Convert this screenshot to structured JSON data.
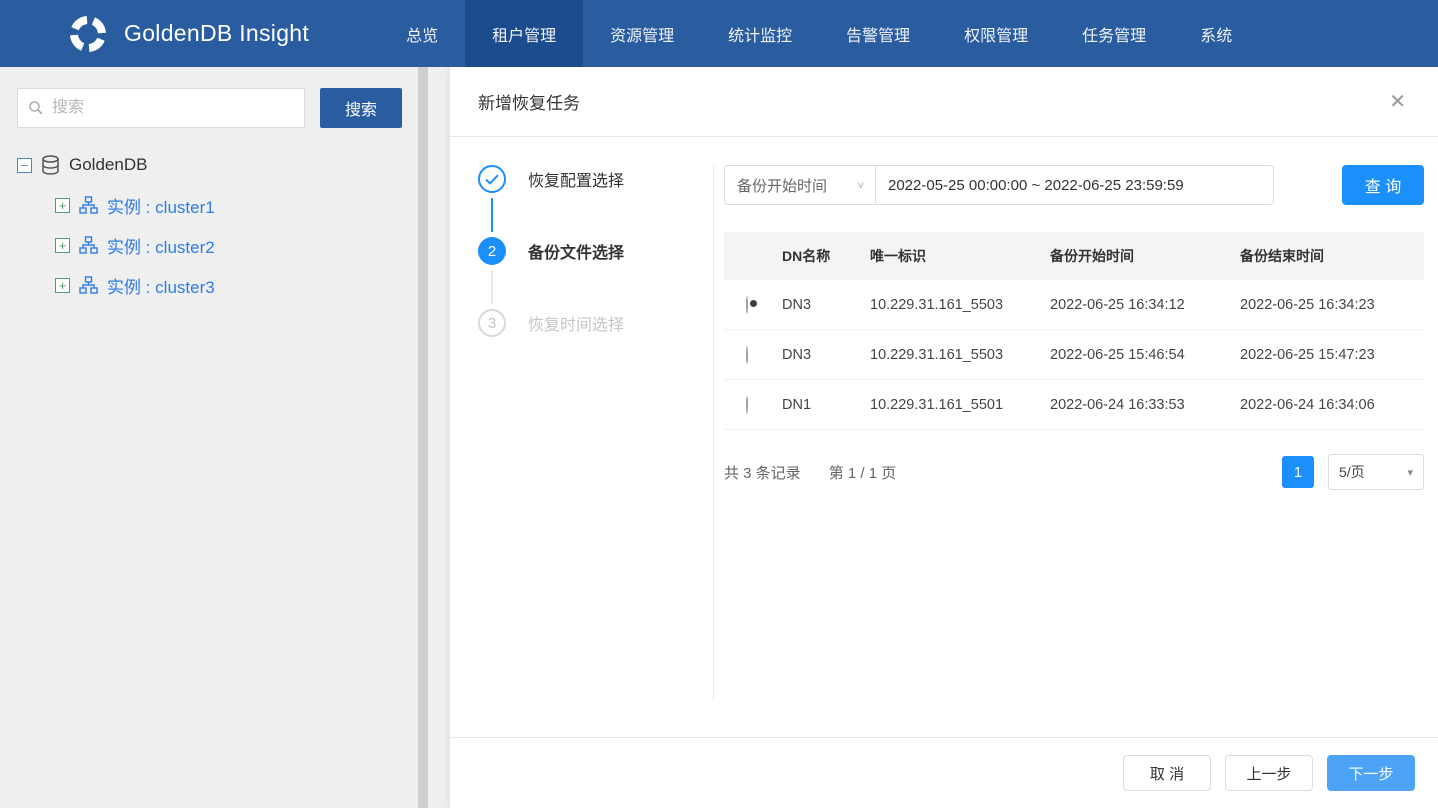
{
  "navbar": {
    "brand": "GoldenDB Insight",
    "items": [
      {
        "label": "总览",
        "active": false
      },
      {
        "label": "租户管理",
        "active": true
      },
      {
        "label": "资源管理",
        "active": false
      },
      {
        "label": "统计监控",
        "active": false
      },
      {
        "label": "告警管理",
        "active": false
      },
      {
        "label": "权限管理",
        "active": false
      },
      {
        "label": "任务管理",
        "active": false
      },
      {
        "label": "系统",
        "active": false
      }
    ]
  },
  "sidebar": {
    "search_placeholder": "搜索",
    "search_button": "搜索",
    "tree": {
      "root": "GoldenDB",
      "children": [
        {
          "label": "实例 : cluster1"
        },
        {
          "label": "实例 : cluster2"
        },
        {
          "label": "实例 : cluster3"
        }
      ]
    }
  },
  "modal": {
    "title": "新增恢复任务",
    "steps": [
      {
        "label": "恢复配置选择",
        "state": "done"
      },
      {
        "label": "备份文件选择",
        "state": "active",
        "num": "2"
      },
      {
        "label": "恢复时间选择",
        "state": "pending",
        "num": "3"
      }
    ],
    "filter": {
      "field_select": "备份开始时间",
      "date_range": "2022-05-25 00:00:00 ~ 2022-06-25 23:59:59",
      "query_button": "查 询"
    },
    "table": {
      "headers": [
        "DN名称",
        "唯一标识",
        "备份开始时间",
        "备份结束时间"
      ],
      "rows": [
        {
          "selected": true,
          "dn": "DN3",
          "id": "10.229.31.161_5503",
          "start": "2022-06-25 16:34:12",
          "end": "2022-06-25 16:34:23"
        },
        {
          "selected": false,
          "dn": "DN3",
          "id": "10.229.31.161_5503",
          "start": "2022-06-25 15:46:54",
          "end": "2022-06-25 15:47:23"
        },
        {
          "selected": false,
          "dn": "DN1",
          "id": "10.229.31.161_5501",
          "start": "2022-06-24 16:33:53",
          "end": "2022-06-24 16:34:06"
        }
      ]
    },
    "pagination": {
      "total_text": "共 3 条记录",
      "page_text": "第 1 / 1 页",
      "current_page": "1",
      "page_size": "5/页"
    },
    "footer": {
      "cancel": "取 消",
      "prev": "上一步",
      "next": "下一步"
    }
  },
  "icons": {
    "close": "✕",
    "select_chevron": "∨",
    "pagesize_arrow": "▾",
    "tree_collapse": "−",
    "tree_expand": "+"
  },
  "colors": {
    "navbar": "#2a5da0",
    "navbar_active": "#1c4b8e",
    "accent_blue": "#1b90fb",
    "tree_link": "#2d7ce8"
  }
}
